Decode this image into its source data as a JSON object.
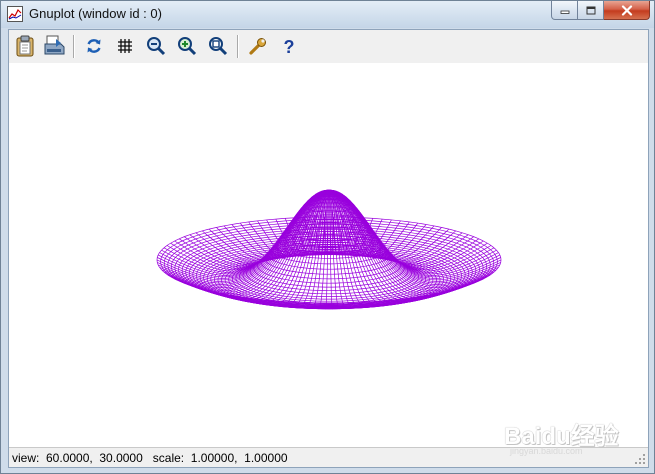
{
  "window": {
    "title": "Gnuplot (window id : 0)"
  },
  "toolbar": {
    "buttons": [
      {
        "name": "copy-to-clipboard",
        "icon": "clipboard-icon"
      },
      {
        "name": "print",
        "icon": "printer-icon"
      },
      {
        "name": "replot",
        "icon": "refresh-icon"
      },
      {
        "name": "toggle-grid",
        "icon": "grid-icon"
      },
      {
        "name": "zoom-previous",
        "icon": "zoom-previous-icon"
      },
      {
        "name": "zoom-next",
        "icon": "zoom-next-icon"
      },
      {
        "name": "autoscale",
        "icon": "zoom-autoscale-icon"
      },
      {
        "name": "options",
        "icon": "wrench-icon"
      },
      {
        "name": "help",
        "icon": "help-icon"
      }
    ]
  },
  "status": {
    "text": "view:  60.0000,  30.0000   scale:  1.00000,  1.00000"
  },
  "plot": {
    "surface_color": "#9900dd",
    "type": "3d-surface-mesh",
    "shape": "sombrero"
  },
  "watermark": {
    "text": "Baidu经验",
    "sub": "jingyan.baidu.com"
  }
}
